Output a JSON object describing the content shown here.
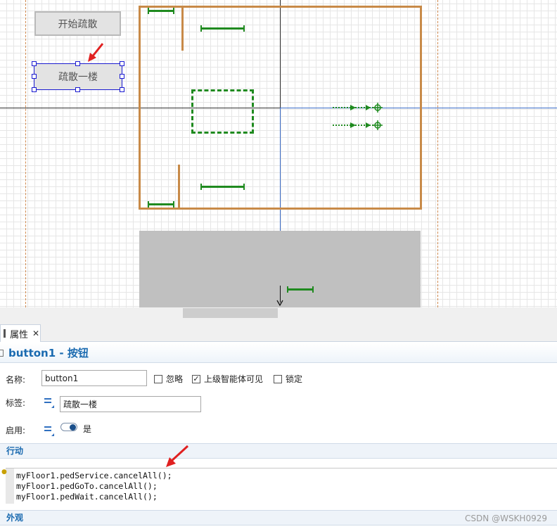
{
  "canvas": {
    "buttons": {
      "start_label": "开始疏散",
      "evac_label": "疏散一楼"
    }
  },
  "properties": {
    "tab_label": "属性",
    "title": "button1 - 按钮",
    "name_label": "名称:",
    "name_value": "button1",
    "ignore_label": "忽略",
    "visible_label": "上级智能体可见",
    "lock_label": "锁定",
    "label_label": "标签:",
    "label_value": "疏散一楼",
    "enabled_label": "启用:",
    "enabled_value": "是",
    "action_section": "行动",
    "code_lines": [
      "myFloor1.pedService.cancelAll();",
      "myFloor1.pedGoTo.cancelAll();",
      "myFloor1.pedWait.cancelAll();"
    ],
    "appearance_section": "外观",
    "checkbox_visible_checked": "✓"
  },
  "watermark": "CSDN @WSKH0929",
  "colors": {
    "accent_blue": "#1a6ab0",
    "wall_orange": "#c88a48",
    "path_green": "#1f8a1f",
    "annotation_red": "#e02020"
  }
}
